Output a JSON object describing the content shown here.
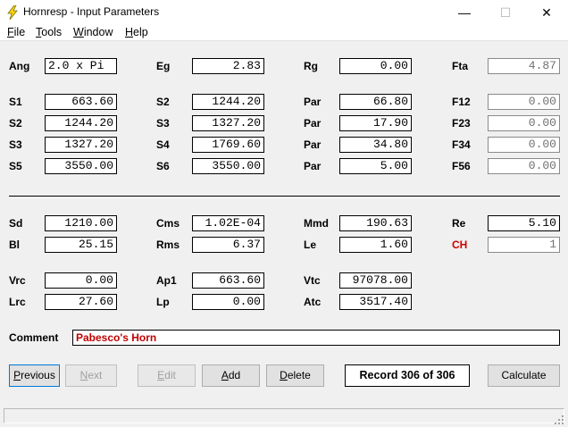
{
  "window": {
    "title": "Hornresp - Input Parameters",
    "minimize_glyph": "—",
    "maximize_glyph": "☐",
    "close_glyph": "✕",
    "icon": "lightning-bolt-icon"
  },
  "menu": [
    {
      "label": "File",
      "accel": "F",
      "rest": "ile"
    },
    {
      "label": "Tools",
      "accel": "T",
      "rest": "ools"
    },
    {
      "label": "Window",
      "accel": "W",
      "rest": "indow"
    },
    {
      "label": "Help",
      "accel": "H",
      "rest": "elp"
    }
  ],
  "params": {
    "ang": {
      "label": "Ang",
      "value": "2.0 x Pi"
    },
    "eg": {
      "label": "Eg",
      "value": "2.83"
    },
    "rg": {
      "label": "Rg",
      "value": "0.00"
    },
    "fta": {
      "label": "Fta",
      "value": "4.87"
    },
    "s1a": {
      "label": "S1",
      "value": "663.60"
    },
    "s2a": {
      "label": "S2",
      "value": "1244.20"
    },
    "par1": {
      "label": "Par",
      "value": "66.80"
    },
    "f12": {
      "label": "F12",
      "value": "0.00"
    },
    "s2b": {
      "label": "S2",
      "value": "1244.20"
    },
    "s3a": {
      "label": "S3",
      "value": "1327.20"
    },
    "par2": {
      "label": "Par",
      "value": "17.90"
    },
    "f23": {
      "label": "F23",
      "value": "0.00"
    },
    "s3b": {
      "label": "S3",
      "value": "1327.20"
    },
    "s4": {
      "label": "S4",
      "value": "1769.60"
    },
    "par3": {
      "label": "Par",
      "value": "34.80"
    },
    "f34": {
      "label": "F34",
      "value": "0.00"
    },
    "s5": {
      "label": "S5",
      "value": "3550.00"
    },
    "s6": {
      "label": "S6",
      "value": "3550.00"
    },
    "par4": {
      "label": "Par",
      "value": "5.00"
    },
    "f56": {
      "label": "F56",
      "value": "0.00"
    },
    "sd": {
      "label": "Sd",
      "value": "1210.00"
    },
    "cms": {
      "label": "Cms",
      "value": "1.02E-04"
    },
    "mmd": {
      "label": "Mmd",
      "value": "190.63"
    },
    "re": {
      "label": "Re",
      "value": "5.10"
    },
    "bl": {
      "label": "Bl",
      "value": "25.15"
    },
    "rms": {
      "label": "Rms",
      "value": "6.37"
    },
    "le": {
      "label": "Le",
      "value": "1.60"
    },
    "ch": {
      "label": "CH",
      "value": "1"
    },
    "vrc": {
      "label": "Vrc",
      "value": "0.00"
    },
    "ap1": {
      "label": "Ap1",
      "value": "663.60"
    },
    "vtc": {
      "label": "Vtc",
      "value": "97078.00"
    },
    "lrc": {
      "label": "Lrc",
      "value": "27.60"
    },
    "lp": {
      "label": "Lp",
      "value": "0.00"
    },
    "atc": {
      "label": "Atc",
      "value": "3517.40"
    }
  },
  "comment": {
    "label": "Comment",
    "value": "Pabesco's Horn"
  },
  "buttons": {
    "previous": {
      "label": "Previous",
      "accel": "P",
      "rest": "revious"
    },
    "next": {
      "label": "Next",
      "accel": "N",
      "rest": "ext"
    },
    "edit": {
      "label": "Edit",
      "accel": "E",
      "rest": "dit"
    },
    "add": {
      "label": "Add",
      "accel": "A",
      "rest": "dd"
    },
    "delete": {
      "label": "Delete",
      "accel": "D",
      "rest": "elete"
    },
    "calculate": {
      "label": "Calculate"
    }
  },
  "record": "Record 306 of 306",
  "colors": {
    "accent_red": "#d00000",
    "focus_blue": "#0078d7",
    "icon_yellow": "#ffd800"
  }
}
